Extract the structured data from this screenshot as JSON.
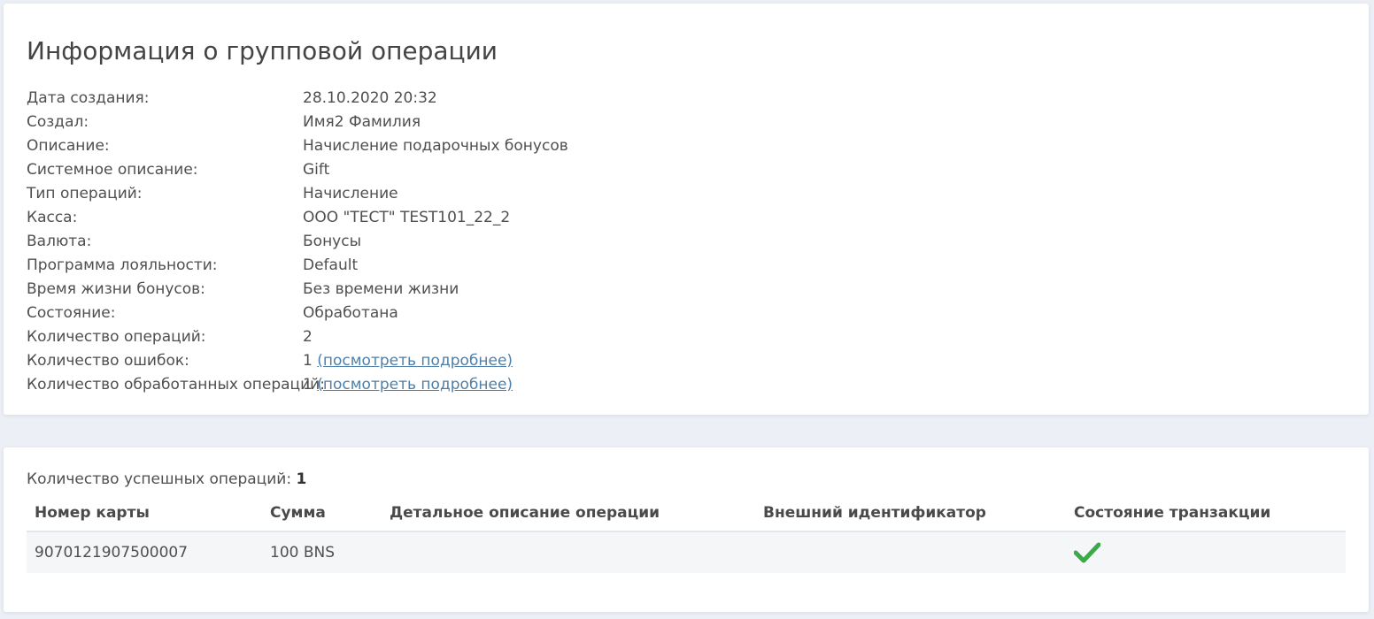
{
  "info": {
    "title": "Информация о групповой операции",
    "rows": [
      {
        "label": "Дата создания:",
        "value": "28.10.2020 20:32"
      },
      {
        "label": "Создал:",
        "value": "Имя2 Фамилия"
      },
      {
        "label": "Описание:",
        "value": "Начисление подарочных бонусов"
      },
      {
        "label": "Системное описание:",
        "value": "Gift"
      },
      {
        "label": "Тип операций:",
        "value": "Начисление"
      },
      {
        "label": "Касса:",
        "value": "ООО \"ТЕСТ\" TEST101_22_2"
      },
      {
        "label": "Валюта:",
        "value": "Бонусы"
      },
      {
        "label": "Программа лояльности:",
        "value": "Default"
      },
      {
        "label": "Время жизни бонусов:",
        "value": "Без времени жизни"
      },
      {
        "label": "Состояние:",
        "value": "Обработана"
      },
      {
        "label": "Количество операций:",
        "value": "2"
      },
      {
        "label": "Количество ошибок:",
        "value": "1",
        "link": "(посмотреть подробнее)"
      },
      {
        "label": "Количество обработанных операций:",
        "value": "1",
        "link": "(посмотреть подробнее)"
      }
    ]
  },
  "operations": {
    "summary_label": "Количество успешных операций:",
    "summary_count": "1",
    "columns": [
      "Номер карты",
      "Сумма",
      "Детальное описание операции",
      "Внешний идентификатор",
      "Состояние транзакции"
    ],
    "rows": [
      {
        "card_number": "9070121907500007",
        "amount": "100 BNS",
        "description": "",
        "external_id": "",
        "status_icon": "check-icon"
      }
    ]
  },
  "colors": {
    "link": "#4f7fa8",
    "success": "#3aaa4a",
    "background": "#eceff5"
  }
}
